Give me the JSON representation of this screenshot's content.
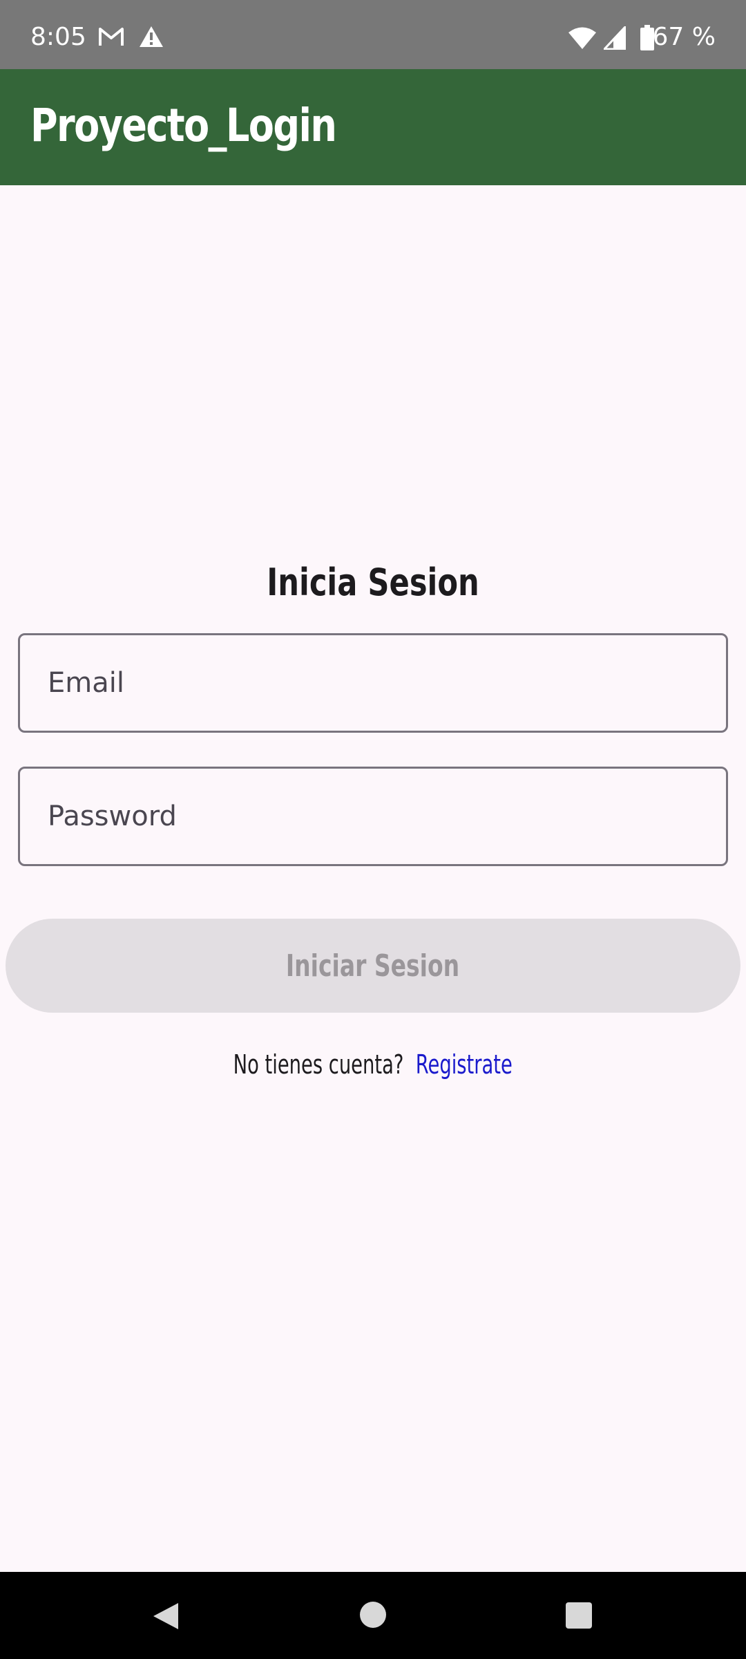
{
  "status_bar": {
    "time": "8:05",
    "battery": "67 %",
    "icons": [
      "gmail-icon",
      "warning-icon",
      "wifi-icon",
      "signal-icon",
      "battery-icon"
    ]
  },
  "app_bar": {
    "title": "Proyecto_Login",
    "color": "#346639"
  },
  "login": {
    "heading": "Inicia Sesion",
    "email_placeholder": "Email",
    "password_placeholder": "Password",
    "submit_label": "Iniciar Sesion",
    "register_prompt": "No tienes cuenta?",
    "register_link": "Registrate"
  },
  "nav_bar": {
    "icons": [
      "back-icon",
      "home-icon",
      "recents-icon"
    ]
  }
}
